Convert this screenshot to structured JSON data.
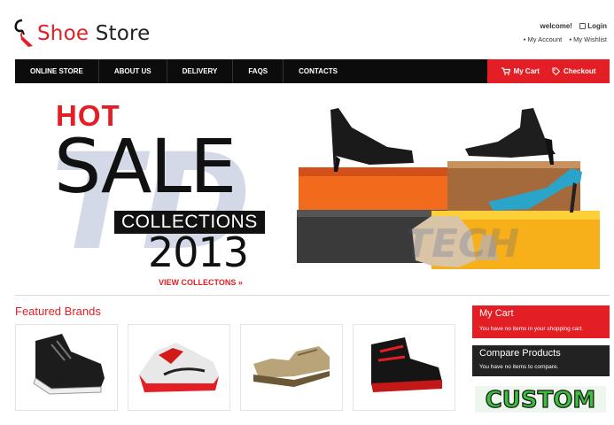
{
  "brand": {
    "part1": "Shoe",
    "part2": "Store"
  },
  "account": {
    "welcome": "welcome!",
    "login": "Login",
    "my_account": "My Account",
    "my_wishlist": "My Wishlist"
  },
  "nav": {
    "items": [
      "ONLINE STORE",
      "ABOUT US",
      "DELIVERY",
      "FAQS",
      "CONTACTS"
    ],
    "cart": "My Cart",
    "checkout": "Checkout"
  },
  "banner": {
    "hot": "HOT",
    "sale": "SALE",
    "collections": "COLLECTIONS",
    "year": "2013",
    "view_link": "VIEW COLLECTONS »"
  },
  "featured": {
    "title": "Featured Brands"
  },
  "sidebar": {
    "cart_title": "My Cart",
    "cart_text": "You have no items in your shopping cart.",
    "compare_title": "Compare Products",
    "compare_text": "You have no items to compare.",
    "custom": "CUSTOM"
  },
  "colors": {
    "accent": "#e31e24",
    "nav_bg": "#0c0c0c",
    "compare_bg": "#222222",
    "custom_green": "#3cbf3c"
  }
}
